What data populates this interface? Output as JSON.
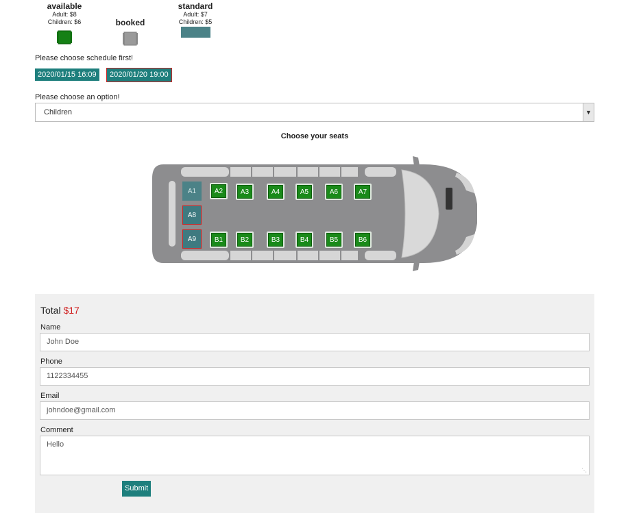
{
  "legend": {
    "available": {
      "title": "available",
      "adult": "Adult: $8",
      "children": "Children: $6",
      "color": "#1a8a1a"
    },
    "booked": {
      "title": "booked",
      "color": "#9a9a9a"
    },
    "standard": {
      "title": "standard",
      "adult": "Adult: $7",
      "children": "Children: $5",
      "color": "#4b8287"
    }
  },
  "schedule": {
    "prompt": "Please choose schedule first!",
    "options": [
      {
        "label": "2020/01/15 16:09",
        "selected": false
      },
      {
        "label": "2020/01/20 19:00",
        "selected": true
      }
    ]
  },
  "ticket_option": {
    "prompt": "Please choose an option!",
    "selected": "Children"
  },
  "seat_map": {
    "title": "Choose your seats",
    "seats": {
      "A1": {
        "label": "A1",
        "status": "standard"
      },
      "A8": {
        "label": "A8",
        "status": "standard-selected"
      },
      "A9": {
        "label": "A9",
        "status": "standard-selected"
      },
      "A2": {
        "label": "A2",
        "status": "available"
      },
      "A3": {
        "label": "A3",
        "status": "available"
      },
      "A4": {
        "label": "A4",
        "status": "available"
      },
      "A5": {
        "label": "A5",
        "status": "available"
      },
      "A6": {
        "label": "A6",
        "status": "available"
      },
      "A7": {
        "label": "A7",
        "status": "available"
      },
      "B1": {
        "label": "B1",
        "status": "available"
      },
      "B2": {
        "label": "B2",
        "status": "available"
      },
      "B3": {
        "label": "B3",
        "status": "available"
      },
      "B4": {
        "label": "B4",
        "status": "available"
      },
      "B5": {
        "label": "B5",
        "status": "available"
      },
      "B6": {
        "label": "B6",
        "status": "available"
      }
    }
  },
  "form": {
    "total_label": "Total",
    "total_amount": "$17",
    "name_label": "Name",
    "name_value": "John Doe",
    "phone_label": "Phone",
    "phone_value": "1122334455",
    "email_label": "Email",
    "email_value": "johndoe@gmail.com",
    "comment_label": "Comment",
    "comment_value": "Hello",
    "submit_label": "Submit"
  },
  "colors": {
    "accent": "#1e7f7d",
    "available": "#1a8a1a",
    "standard": "#4b8287",
    "price": "#d02020",
    "selected_border": "#cc2222"
  }
}
